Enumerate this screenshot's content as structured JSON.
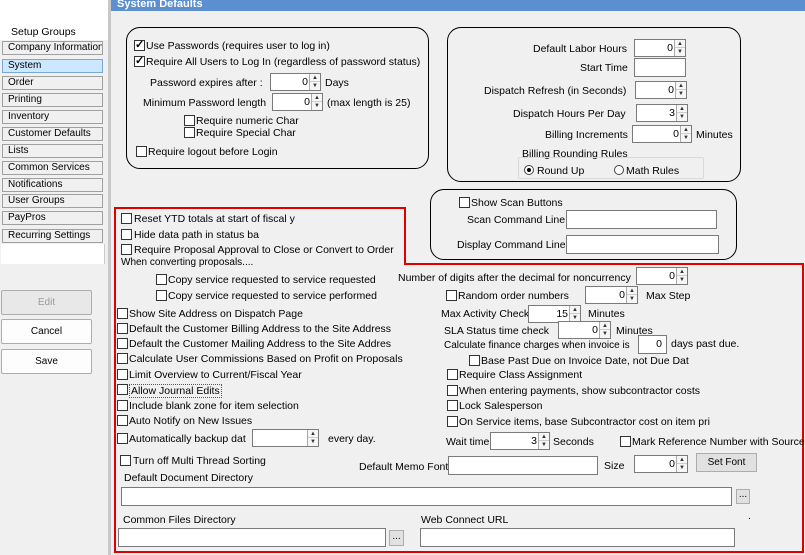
{
  "window": {
    "title": "System Defaults"
  },
  "sidebar": {
    "header": "Setup Groups",
    "items": [
      {
        "label": "Company Information"
      },
      {
        "label": "System"
      },
      {
        "label": "Order"
      },
      {
        "label": "Printing"
      },
      {
        "label": "Inventory"
      },
      {
        "label": "Customer Defaults"
      },
      {
        "label": "Lists"
      },
      {
        "label": "Common Services"
      },
      {
        "label": "Notifications"
      },
      {
        "label": "User Groups"
      },
      {
        "label": "PayPros"
      },
      {
        "label": "Recurring Settings"
      }
    ],
    "selected": "System",
    "edit_label": "Edit",
    "cancel_label": "Cancel",
    "save_label": "Save"
  },
  "security": {
    "use_passwords": "Use Passwords (requires user to log in)",
    "require_all_users": "Require All Users to Log In (regardless of password status)",
    "password_expires_label": "Password expires after :",
    "password_expires_value": "0",
    "days_label": "Days",
    "min_length_label": "Minimum Password length",
    "min_length_value": "0",
    "max_length_note": "(max length is 25)",
    "require_numeric": "Require numeric Char",
    "require_special": "Require Special Char",
    "require_logout": "Require logout before Login"
  },
  "dispatch": {
    "labor_hours_label": "Default Labor Hours",
    "labor_hours_value": "0",
    "start_time_label": "Start Time",
    "start_time_value": "",
    "refresh_label": "Dispatch Refresh (in Seconds)",
    "refresh_value": "0",
    "hours_per_day_label": "Dispatch Hours Per Day",
    "hours_per_day_value": "3",
    "billing_increments_label": "Billing Increments",
    "billing_increments_value": "0",
    "minutes_label": "Minutes",
    "rounding_label": "Billing Rounding Rules",
    "round_up": "Round Up",
    "math_rules": "Math Rules"
  },
  "scan": {
    "show_scan_buttons": "Show Scan Buttons",
    "scan_command_label": "Scan Command Line",
    "display_command_label": "Display Command Line"
  },
  "options": {
    "reset_ytd": "Reset YTD totals at start of fiscal y",
    "hide_data_path": "Hide data path in status ba",
    "require_proposal": "Require Proposal Approval to Close or Convert to Order",
    "when_converting": "When converting proposals....",
    "copy_requested": "Copy service requested to service requested",
    "copy_performed": "Copy service requested to service performed",
    "digits_label": "Number of digits after the decimal for noncurrency",
    "digits_value": "0",
    "random_order": "Random order numbers",
    "max_step_value": "0",
    "max_step_label": "Max Step",
    "show_site_address": "Show Site Address on Dispatch Page",
    "default_billing": "Default the Customer Billing Address to the Site Address",
    "default_mailing": "Default the Customer Mailing Address to the Site Addres",
    "calc_commissions": "Calculate User Commissions Based on Profit on Proposals",
    "limit_overview": "Limit Overview to Current/Fiscal Year",
    "allow_journal": "Allow Journal Edits",
    "include_blank": "Include blank zone for item selection",
    "auto_notify": "Auto Notify on New Issues",
    "auto_backup": "Automatically backup dat",
    "every_day": "every day.",
    "turn_off_threads": "Turn off Multi Thread Sorting",
    "max_activity_label": "Max Activity Check",
    "max_activity_value": "15",
    "max_activity_unit": "Minutes",
    "sla_label": "SLA Status time check",
    "sla_value": "0",
    "sla_unit": "Minutes",
    "finance_label": "Calculate finance charges when invoice is",
    "finance_value": "0",
    "finance_unit": "days past due.",
    "base_past_due": "Base Past Due on Invoice Date, not Due Dat",
    "require_class": "Require Class Assignment",
    "subcontractor_costs": "When entering payments, show subcontractor costs",
    "lock_salesperson": "Lock Salesperson",
    "on_service_items": "On Service items, base Subcontractor cost on item pri",
    "wait_time_label": "Wait time",
    "wait_time_value": "3",
    "seconds_label": "Seconds",
    "mark_reference": "Mark Reference Number with Source",
    "memo_font_label": "Default Memo Font",
    "size_label": "Size",
    "size_value": "0",
    "set_font": "Set Font",
    "doc_dir_label": "Default Document Directory",
    "browse": "...",
    "common_files_label": "Common Files Directory",
    "web_connect_label": "Web Connect URL",
    "dot": "."
  }
}
